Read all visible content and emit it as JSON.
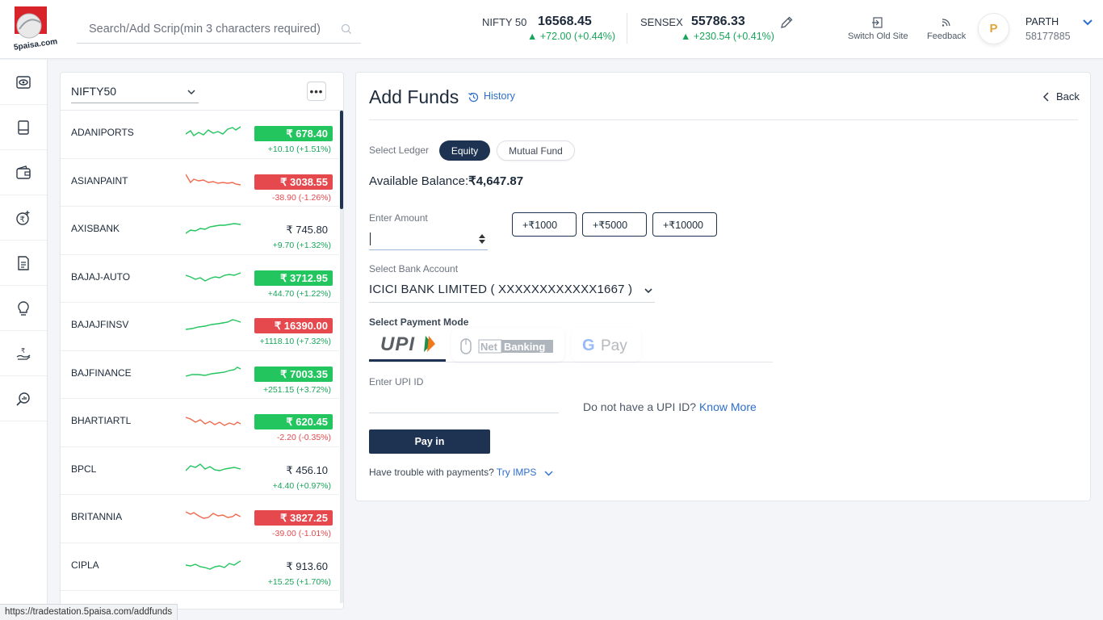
{
  "header": {
    "logo_text": "5paisa.com",
    "search_placeholder": "Search/Add Scrip(min 3 characters required)",
    "indices": [
      {
        "name": "NIFTY 50",
        "value": "16568.45",
        "change": "+72.00 (+0.44%)"
      },
      {
        "name": "SENSEX",
        "value": "55786.33",
        "change": "+230.54 (+0.41%)"
      }
    ],
    "switch_old_site": "Switch Old Site",
    "feedback": "Feedback",
    "avatar_initial": "P",
    "user_name": "PARTH",
    "user_id": "58177885"
  },
  "rail": {
    "icons": [
      "eye-icon",
      "book-icon",
      "wallet-icon",
      "rupee-add-icon",
      "document-icon",
      "bulb-icon",
      "hand-rupee-icon",
      "search-chart-icon"
    ]
  },
  "watchlist": {
    "selected": "NIFTY50",
    "more_label": "•••",
    "rows": [
      {
        "name": "ADANIPORTS",
        "price": "₹ 678.40",
        "change": "+10.10 (+1.51%)",
        "dir": "up",
        "badge": "up"
      },
      {
        "name": "ASIANPAINT",
        "price": "₹ 3038.55",
        "change": "-38.90 (-1.26%)",
        "dir": "dn",
        "badge": "dn"
      },
      {
        "name": "AXISBANK",
        "price": "₹ 745.80",
        "change": "+9.70 (+1.32%)",
        "dir": "up",
        "badge": "plain"
      },
      {
        "name": "BAJAJ-AUTO",
        "price": "₹ 3712.95",
        "change": "+44.70 (+1.22%)",
        "dir": "up",
        "badge": "up"
      },
      {
        "name": "BAJAJFINSV",
        "price": "₹ 16390.00",
        "change": "+1118.10 (+7.32%)",
        "dir": "up",
        "badge": "dn"
      },
      {
        "name": "BAJFINANCE",
        "price": "₹ 7003.35",
        "change": "+251.15 (+3.72%)",
        "dir": "up",
        "badge": "up"
      },
      {
        "name": "BHARTIARTL",
        "price": "₹ 620.45",
        "change": "-2.20 (-0.35%)",
        "dir": "dn",
        "badge": "up"
      },
      {
        "name": "BPCL",
        "price": "₹ 456.10",
        "change": "+4.40 (+0.97%)",
        "dir": "up",
        "badge": "plain"
      },
      {
        "name": "BRITANNIA",
        "price": "₹ 3827.25",
        "change": "-39.00 (-1.01%)",
        "dir": "dn",
        "badge": "dn"
      },
      {
        "name": "CIPLA",
        "price": "₹ 913.60",
        "change": "+15.25 (+1.70%)",
        "dir": "up",
        "badge": "plain"
      }
    ]
  },
  "funds": {
    "title": "Add Funds",
    "history": "History",
    "back": "Back",
    "ledger_label": "Select Ledger",
    "ledger_tabs": [
      "Equity",
      "Mutual Fund"
    ],
    "balance_label": "Available Balance:",
    "balance_value": "₹4,647.87",
    "amount_label": "Enter Amount",
    "quick_amounts": [
      "+₹1000",
      "+₹5000",
      "+₹10000"
    ],
    "bank_label": "Select Bank Account",
    "bank_value": "ICICI BANK LIMITED ( XXXXXXXXXXXX1667 )",
    "mode_label": "Select Payment Mode",
    "modes": [
      "UPI",
      "Net Banking",
      "G Pay"
    ],
    "upi_label": "Enter UPI ID",
    "upi_help": "Do not have a UPI ID?",
    "upi_know_more": "Know More",
    "pay_button": "Pay in",
    "trouble_text": "Have trouble with payments?",
    "trouble_link": "Try IMPS"
  },
  "status_url": "https://tradestation.5paisa.com/addfunds",
  "colors": {
    "navy": "#1e3352",
    "green": "#22c55e",
    "red": "#e5484d",
    "link": "#2c6ecb"
  }
}
